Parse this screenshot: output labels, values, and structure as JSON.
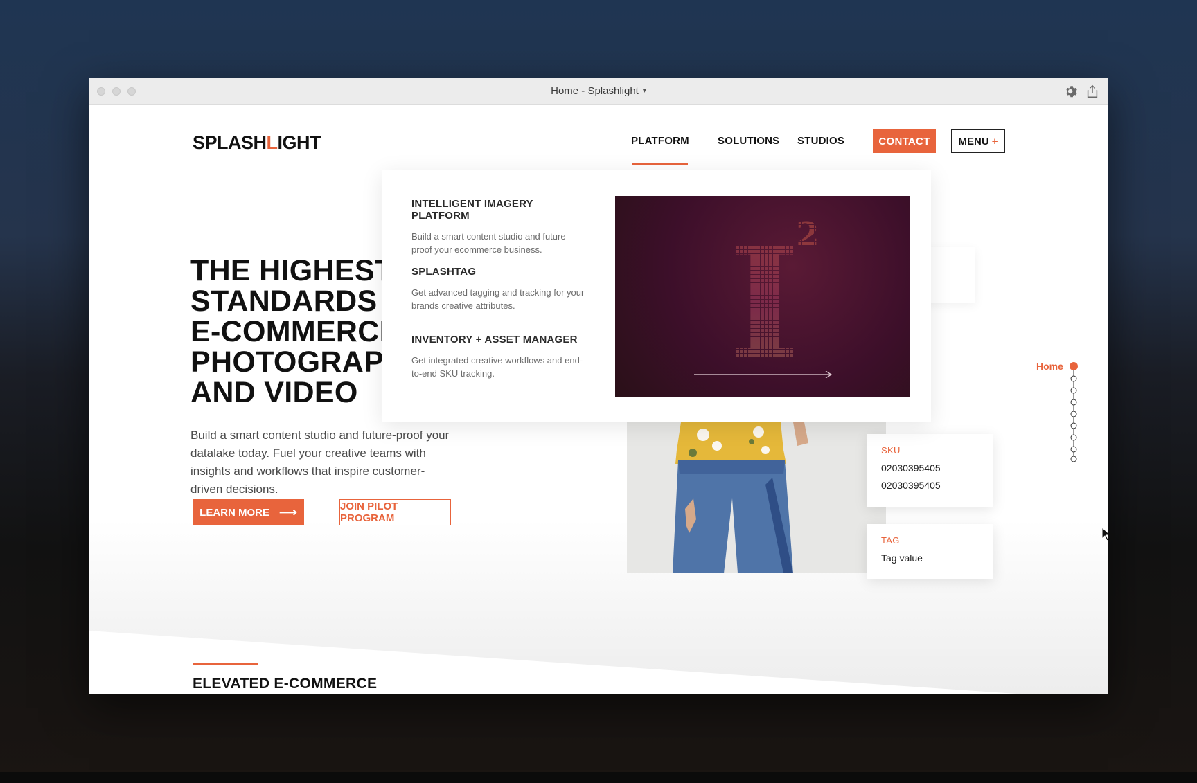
{
  "window": {
    "title": "Home - Splashlight",
    "title_caret": "▾"
  },
  "header": {
    "logo_pre": "SPLASH",
    "logo_accent": "L",
    "logo_post": "IGHT",
    "nav": {
      "platform": "PLATFORM",
      "solutions": "SOLUTIONS",
      "studios": "STUDIOS"
    },
    "contact_label": "CONTACT",
    "menu_label": "MENU",
    "menu_plus": "+"
  },
  "hero": {
    "title_lines": [
      "THE HIGHEST",
      "STANDARDS",
      "E-COMMERCE",
      "PHOTOGRAPHY",
      "AND VIDEO"
    ],
    "subtitle": "Build a smart content studio and future-proof your datalake today. Fuel your creative teams with insights and workflows that inspire customer-driven decisions.",
    "learn_more_label": "LEARN MORE",
    "learn_more_arrow": "⟶",
    "pilot_label": "JOIN PILOT PROGRAM"
  },
  "dropdown": {
    "items": [
      {
        "title": "INTELLIGENT IMAGERY PLATFORM",
        "desc": "Build a smart content studio and future proof your ecommerce business."
      },
      {
        "title": "SPLASHTAG",
        "desc": "Get advanced tagging and tracking for your brands creative attributes."
      },
      {
        "title": "INVENTORY + ASSET MANAGER",
        "desc": "Get integrated creative workflows and end-to-end SKU tracking."
      }
    ],
    "image_glyph": "I",
    "image_exponent": "2"
  },
  "product": {
    "sku_label": "SKU",
    "sku_values": [
      "02030395405",
      "02030395405"
    ],
    "tag_label": "TAG",
    "tag_value": "Tag value"
  },
  "scroll_nav": {
    "active_label": "Home",
    "dot_count": 9
  },
  "section": {
    "title": "ELEVATED E-COMMERCE"
  },
  "colors": {
    "accent": "#e8643c",
    "dark_text": "#111111",
    "image_bg": "#3d0f2a"
  },
  "icons": {
    "settings": "gear-icon",
    "share": "share-icon",
    "arrow": "arrow-right-icon"
  }
}
